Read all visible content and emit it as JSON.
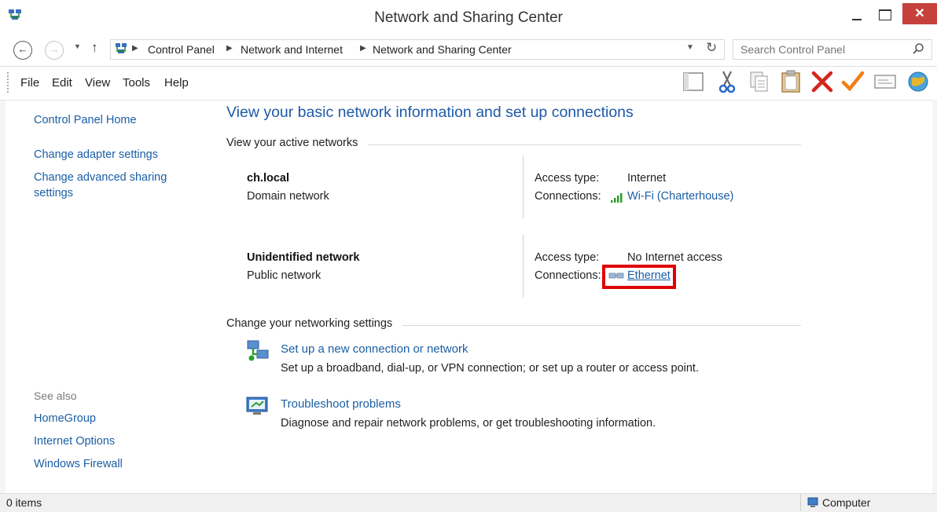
{
  "window": {
    "title": "Network and Sharing Center",
    "close_label": "✕"
  },
  "address": {
    "crumbs": [
      "Control Panel",
      "Network and Internet",
      "Network and Sharing Center"
    ],
    "search_placeholder": "Search Control Panel"
  },
  "menu": {
    "items": [
      "File",
      "Edit",
      "View",
      "Tools",
      "Help"
    ]
  },
  "toolbar": {
    "icons": [
      "layout-icon",
      "cut-icon",
      "copy-icon",
      "paste-icon",
      "delete-icon",
      "check-icon",
      "rename-icon",
      "globe-icon"
    ]
  },
  "sidebar": {
    "home": "Control Panel Home",
    "links": [
      "Change adapter settings",
      "Change advanced sharing settings"
    ],
    "see_also_label": "See also",
    "see_also": [
      "HomeGroup",
      "Internet Options",
      "Windows Firewall"
    ]
  },
  "main": {
    "heading": "View your basic network information and set up connections",
    "active_networks_label": "View your active networks",
    "networks": [
      {
        "name": "ch.local",
        "type": "Domain network",
        "access_label": "Access type:",
        "access_value": "Internet",
        "connections_label": "Connections:",
        "connection": "Wi-Fi (Charterhouse)"
      },
      {
        "name": "Unidentified network",
        "type": "Public network",
        "access_label": "Access type:",
        "access_value": "No Internet access",
        "connections_label": "Connections:",
        "connection": "Ethernet"
      }
    ],
    "settings_label": "Change your networking settings",
    "tasks": [
      {
        "title": "Set up a new connection or network",
        "desc": "Set up a broadband, dial-up, or VPN connection; or set up a router or access point."
      },
      {
        "title": "Troubleshoot problems",
        "desc": "Diagnose and repair network problems, or get troubleshooting information."
      }
    ]
  },
  "status": {
    "items": "0 items",
    "location": "Computer"
  },
  "colors": {
    "link": "#1b5ea5",
    "heading": "#1e5aa8",
    "close": "#c7413c",
    "highlight": "#e00000"
  }
}
